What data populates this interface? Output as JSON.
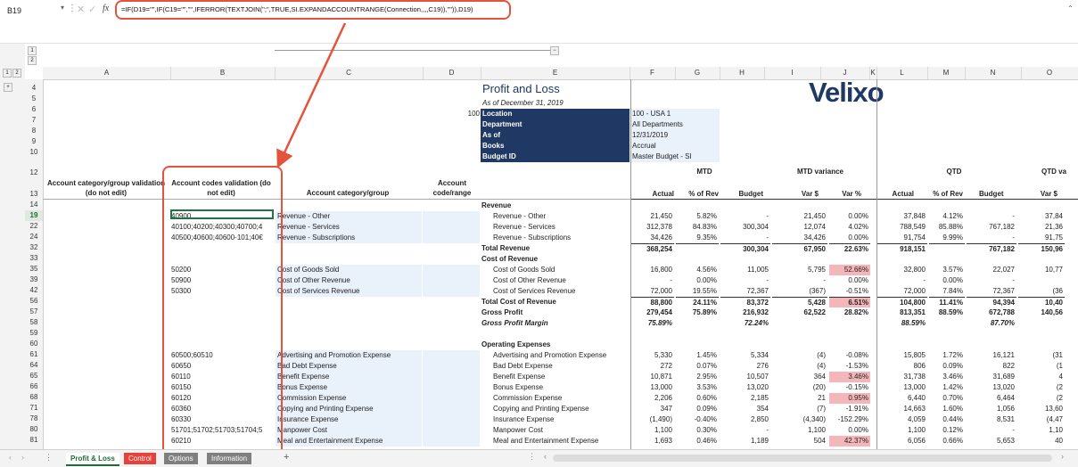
{
  "formula_bar": {
    "name_box": "B19",
    "formula": "=IF(D19=\"\",IF(C19=\"\",\"\",IFERROR(TEXTJOIN(\";\",TRUE,SI.EXPANDACCOUNTRANGE(Connection,,,,C19)),\"\")),D19)",
    "fx": "fx"
  },
  "outline": {
    "row_levels": [
      "1",
      "2"
    ],
    "col_levels": [
      "1",
      "2"
    ],
    "minus": "−",
    "plus": "+"
  },
  "columns": [
    "A",
    "B",
    "C",
    "D",
    "E",
    "F",
    "G",
    "H",
    "I",
    "J",
    "K",
    "L",
    "M",
    "N",
    "O"
  ],
  "rows": [
    "4",
    "5",
    "6",
    "7",
    "8",
    "9",
    "10",
    "12",
    "13",
    "14",
    "19",
    "22",
    "24",
    "32",
    "33",
    "35",
    "39",
    "42",
    "56",
    "57",
    "58",
    "59",
    "60",
    "61",
    "64",
    "65",
    "66",
    "68",
    "71",
    "78",
    "80",
    "81"
  ],
  "report": {
    "title": "Profit and Loss",
    "subtitle": "As of December 31, 2019",
    "param_num": "100",
    "params": [
      {
        "label": "Location",
        "value": "100 - USA 1"
      },
      {
        "label": "Department",
        "value": "All Departments"
      },
      {
        "label": "As of",
        "value": "12/31/2019"
      },
      {
        "label": "Books",
        "value": "Accrual"
      },
      {
        "label": "Budget ID",
        "value": "Master Budget - SI"
      }
    ],
    "logo": "Velixo"
  },
  "headers": {
    "col_a": "Account category/group validation (do not edit)",
    "col_b": "Account codes validation (do not edit)",
    "col_c": "Account category/group",
    "col_d": "Account code/range",
    "mtd": "MTD",
    "mtd_var": "MTD variance",
    "qtd": "QTD",
    "qtd_var": "QTD va",
    "actual": "Actual",
    "pct_rev": "% of Rev",
    "budget": "Budget",
    "var_d": "Var $",
    "var_p": "Var %",
    "actual2": "Actual",
    "pct_rev2": "% of Rev",
    "budget2": "Budget",
    "var_d2": "Var $"
  },
  "lines": [
    {
      "b": "",
      "c": "",
      "e": "Revenue",
      "f": "",
      "g": "",
      "h": "",
      "i": "",
      "j": "",
      "l": "",
      "m": "",
      "n": "",
      "o": ""
    },
    {
      "b": "40900",
      "c": "Revenue - Other",
      "e": "Revenue - Other",
      "f": "21,450",
      "g": "5.82%",
      "h": "-",
      "i": "21,450",
      "j": "0.00%",
      "l": "37,848",
      "m": "4.12%",
      "n": "-",
      "o": "37,84"
    },
    {
      "b": "40100;40200;40300;40700;4",
      "c": "Revenue - Services",
      "e": "Revenue - Services",
      "f": "312,378",
      "g": "84.83%",
      "h": "300,304",
      "i": "12,074",
      "j": "4.02%",
      "l": "788,549",
      "m": "85.88%",
      "n": "767,182",
      "o": "21,36"
    },
    {
      "b": "40500;40600;40600-101;40€",
      "c": "Revenue - Subscriptions",
      "e": "Revenue - Subscriptions",
      "f": "34,426",
      "g": "9.35%",
      "h": "-",
      "i": "34,426",
      "j": "0.00%",
      "l": "91,754",
      "m": "9.99%",
      "n": "-",
      "o": "91,75"
    },
    {
      "b": "",
      "c": "",
      "e": "Total Revenue",
      "f": "368,254",
      "g": "",
      "h": "300,304",
      "i": "67,950",
      "j": "22.63%",
      "l": "918,151",
      "m": "",
      "n": "767,182",
      "o": "150,96"
    },
    {
      "b": "",
      "c": "",
      "e": "Cost of Revenue",
      "f": "",
      "g": "",
      "h": "",
      "i": "",
      "j": "",
      "l": "",
      "m": "",
      "n": "",
      "o": ""
    },
    {
      "b": "50200",
      "c": "Cost of Goods Sold",
      "e": "Cost of Goods Sold",
      "f": "16,800",
      "g": "4.56%",
      "h": "11,005",
      "i": "5,795",
      "j": "52.66%",
      "l": "32,800",
      "m": "3.57%",
      "n": "22,027",
      "o": "10,77"
    },
    {
      "b": "50900",
      "c": "Cost of Other Revenue",
      "e": "Cost of Other Revenue",
      "f": "-",
      "g": "0.00%",
      "h": "-",
      "i": "-",
      "j": "0.00%",
      "l": "-",
      "m": "0.00%",
      "n": "-",
      "o": ""
    },
    {
      "b": "50300",
      "c": "Cost of Services Revenue",
      "e": "Cost of Services Revenue",
      "f": "72,000",
      "g": "19.55%",
      "h": "72,367",
      "i": "(367)",
      "j": "-0.51%",
      "l": "72,000",
      "m": "7.84%",
      "n": "72,367",
      "o": "(36"
    },
    {
      "b": "",
      "c": "",
      "e": "Total Cost of Revenue",
      "f": "88,800",
      "g": "24.11%",
      "h": "83,372",
      "i": "5,428",
      "j": "6.51%",
      "l": "104,800",
      "m": "11.41%",
      "n": "94,394",
      "o": "10,40"
    },
    {
      "b": "",
      "c": "",
      "e": "Gross Profit",
      "f": "279,454",
      "g": "75.89%",
      "h": "216,932",
      "i": "62,522",
      "j": "28.82%",
      "l": "813,351",
      "m": "88.59%",
      "n": "672,788",
      "o": "140,56"
    },
    {
      "b": "",
      "c": "",
      "e": "Gross Profit Margin",
      "f": "75.89%",
      "g": "",
      "h": "72.24%",
      "i": "",
      "j": "",
      "l": "88.59%",
      "m": "",
      "n": "87.70%",
      "o": ""
    },
    {
      "b": "",
      "c": "",
      "e": "",
      "f": "",
      "g": "",
      "h": "",
      "i": "",
      "j": "",
      "l": "",
      "m": "",
      "n": "",
      "o": ""
    },
    {
      "b": "",
      "c": "",
      "e": "Operating Expenses",
      "f": "",
      "g": "",
      "h": "",
      "i": "",
      "j": "",
      "l": "",
      "m": "",
      "n": "",
      "o": ""
    },
    {
      "b": "60500;60510",
      "c": "Advertising and Promotion Expense",
      "e": "Advertising and Promotion Expense",
      "f": "5,330",
      "g": "1.45%",
      "h": "5,334",
      "i": "(4)",
      "j": "-0.08%",
      "l": "15,805",
      "m": "1.72%",
      "n": "16,121",
      "o": "(31"
    },
    {
      "b": "60650",
      "c": "Bad Debt Expense",
      "e": "Bad Debt Expense",
      "f": "272",
      "g": "0.07%",
      "h": "276",
      "i": "(4)",
      "j": "-1.53%",
      "l": "806",
      "m": "0.09%",
      "n": "822",
      "o": "(1"
    },
    {
      "b": "60110",
      "c": "Benefit Expense",
      "e": "Benefit Expense",
      "f": "10,871",
      "g": "2.95%",
      "h": "10,507",
      "i": "364",
      "j": "3.46%",
      "l": "31,738",
      "m": "3.46%",
      "n": "31,689",
      "o": "4"
    },
    {
      "b": "60150",
      "c": "Bonus Expense",
      "e": "Bonus Expense",
      "f": "13,000",
      "g": "3.53%",
      "h": "13,020",
      "i": "(20)",
      "j": "-0.15%",
      "l": "13,000",
      "m": "1.42%",
      "n": "13,020",
      "o": "(2"
    },
    {
      "b": "60120",
      "c": "Commission Expense",
      "e": "Commission Expense",
      "f": "2,206",
      "g": "0.60%",
      "h": "2,185",
      "i": "21",
      "j": "0.95%",
      "l": "6,440",
      "m": "0.70%",
      "n": "6,464",
      "o": "(2"
    },
    {
      "b": "60360",
      "c": "Copying and Printing Expense",
      "e": "Copying and Printing Expense",
      "f": "347",
      "g": "0.09%",
      "h": "354",
      "i": "(7)",
      "j": "-1.91%",
      "l": "14,663",
      "m": "1.60%",
      "n": "1,056",
      "o": "13,60"
    },
    {
      "b": "60330",
      "c": "Insurance Expense",
      "e": "Insurance Expense",
      "f": "(1,490)",
      "g": "-0.40%",
      "h": "2,850",
      "i": "(4,340)",
      "j": "-152.29%",
      "l": "4,059",
      "m": "0.44%",
      "n": "8,531",
      "o": "(4,47"
    },
    {
      "b": "51701;51702;51703;51704;5",
      "c": "Manpower Cost",
      "e": "Manpower Cost",
      "f": "1,100",
      "g": "0.30%",
      "h": "-",
      "i": "1,100",
      "j": "0.00%",
      "l": "1,100",
      "m": "0.12%",
      "n": "-",
      "o": "1,10"
    },
    {
      "b": "60210",
      "c": "Meal and Entertainment Expense",
      "e": "Meal and Entertainment Expense",
      "f": "1,693",
      "g": "0.46%",
      "h": "1,189",
      "i": "504",
      "j": "42.37%",
      "l": "6,056",
      "m": "0.66%",
      "n": "5,653",
      "o": "40"
    }
  ],
  "sheet_tabs": [
    {
      "label": "Profit & Loss",
      "active": true,
      "color": "#ffffff"
    },
    {
      "label": "Control",
      "active": false,
      "color": "#e8413c"
    },
    {
      "label": "Options",
      "active": false,
      "color": "#7f7f7f"
    },
    {
      "label": "Information",
      "active": false,
      "color": "#7f7f7f"
    }
  ],
  "add_sheet": "+",
  "nav": {
    "prev": "‹",
    "next": "›",
    "more": "⋮"
  }
}
